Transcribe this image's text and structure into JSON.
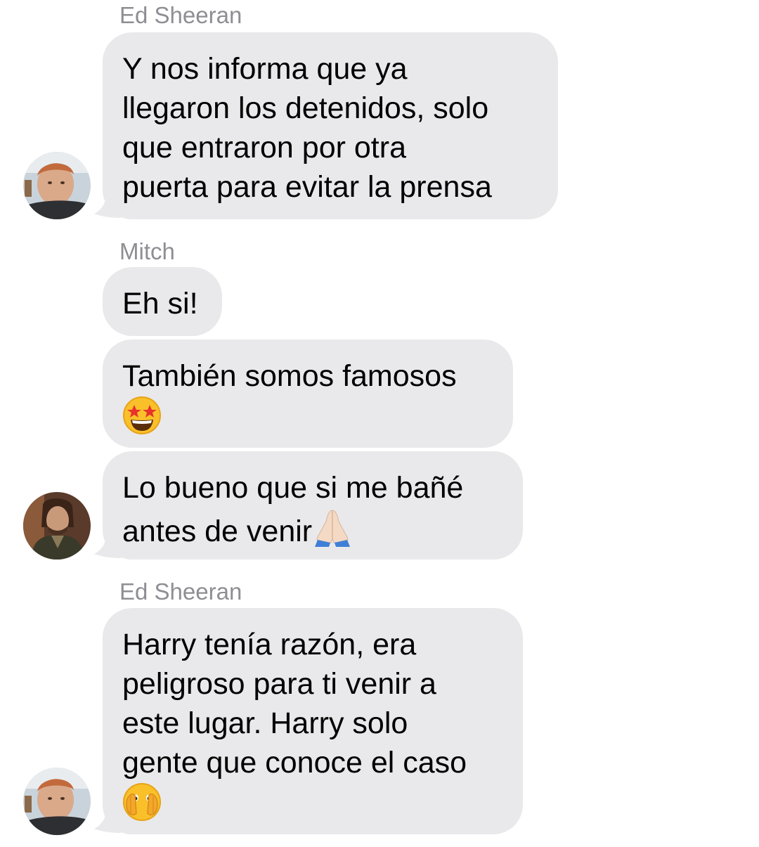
{
  "messages": [
    {
      "sender": "Ed Sheeran",
      "lines": [
        "Y nos informa que ya",
        "llegaron los detenidos, solo",
        "que entraron por otra",
        "puerta para evitar la prensa"
      ]
    },
    {
      "sender": "Mitch",
      "lines": [
        "Eh si!"
      ]
    },
    {
      "lines": [
        "También somos famosos"
      ],
      "emoji": "star-struck-emoji"
    },
    {
      "lines": [
        "Lo bueno que si me bañé",
        "antes de venir"
      ],
      "emoji": "folded-hands-emoji"
    },
    {
      "sender": "Ed Sheeran",
      "lines": [
        "Harry tenía razón, era",
        "peligroso para ti venir a",
        "este lugar. Harry solo",
        "gente que conoce el caso"
      ],
      "emoji": "face-with-peeking-eye-emoji"
    }
  ],
  "colors": {
    "bubble": "#e9e9eb",
    "sender_label": "#8e8e93",
    "text": "#000000",
    "background": "#ffffff"
  }
}
